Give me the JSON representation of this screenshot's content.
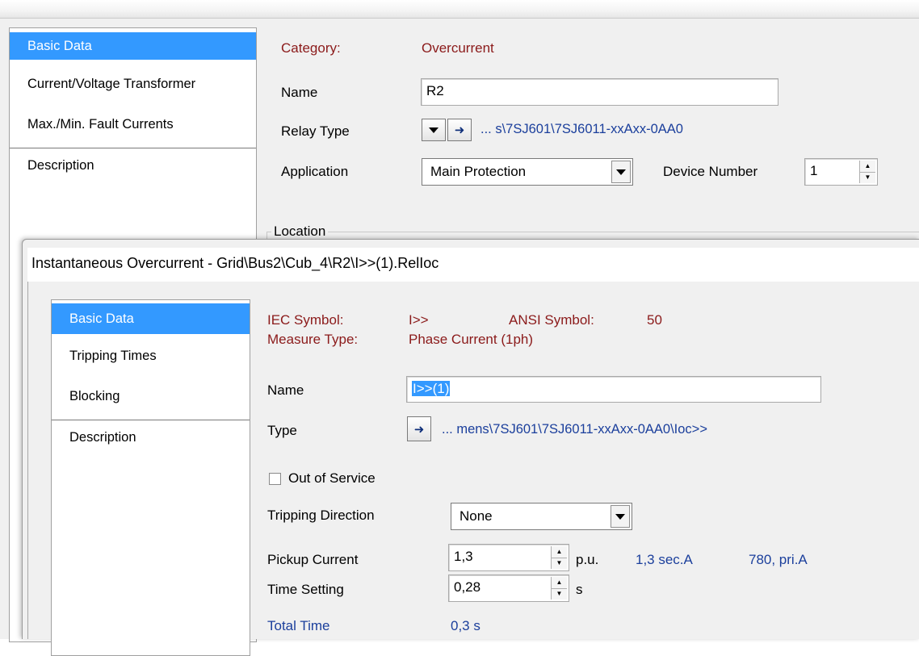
{
  "background_dialog": {
    "sidebar": [
      {
        "label": "Basic Data",
        "selected": true
      },
      {
        "label": "Current/Voltage Transformer",
        "selected": false
      },
      {
        "label": "Max./Min. Fault Currents",
        "selected": false
      },
      {
        "label": "Description",
        "selected": false
      }
    ],
    "category_label": "Category:",
    "category_value": "Overcurrent",
    "name_label": "Name",
    "name_value": "R2",
    "relay_type_label": "Relay Type",
    "relay_type_path": "... s\\7SJ601\\7SJ6011-xxAxx-0AA0",
    "application_label": "Application",
    "application_value": "Main Protection",
    "device_number_label": "Device Number",
    "device_number_value": "1",
    "location_label": "Location"
  },
  "dialog": {
    "title": "Instantaneous Overcurrent - Grid\\Bus2\\Cub_4\\R2\\I>>(1).RelIoc",
    "sidebar": [
      {
        "label": "Basic Data",
        "selected": true
      },
      {
        "label": "Tripping Times",
        "selected": false
      },
      {
        "label": "Blocking",
        "selected": false
      },
      {
        "label": "Description",
        "selected": false
      }
    ],
    "iec_symbol_label": "IEC Symbol:",
    "iec_symbol_value": "I>>",
    "ansi_symbol_label": "ANSI Symbol:",
    "ansi_symbol_value": "50",
    "measure_type_label": "Measure Type:",
    "measure_type_value": "Phase Current (1ph)",
    "name_label": "Name",
    "name_value": "I>>(1)",
    "type_label": "Type",
    "type_path": "... mens\\7SJ601\\7SJ6011-xxAxx-0AA0\\Ioc>>",
    "out_of_service_label": "Out of Service",
    "out_of_service_checked": false,
    "tripping_direction_label": "Tripping Direction",
    "tripping_direction_value": "None",
    "pickup_current_label": "Pickup Current",
    "pickup_current_value": "1,3",
    "pickup_unit": "p.u.",
    "pickup_secondary": "1,3 sec.A",
    "pickup_primary": "780, pri.A",
    "time_setting_label": "Time Setting",
    "time_setting_value": "0,28",
    "time_unit": "s",
    "total_time_label": "Total Time",
    "total_time_value": "0,3 s"
  },
  "colors": {
    "selection": "#3399ff",
    "maroon_label": "#8b1a1a",
    "blue_link": "#1b3f9c",
    "dialog_bg": "#f0f0f0"
  }
}
